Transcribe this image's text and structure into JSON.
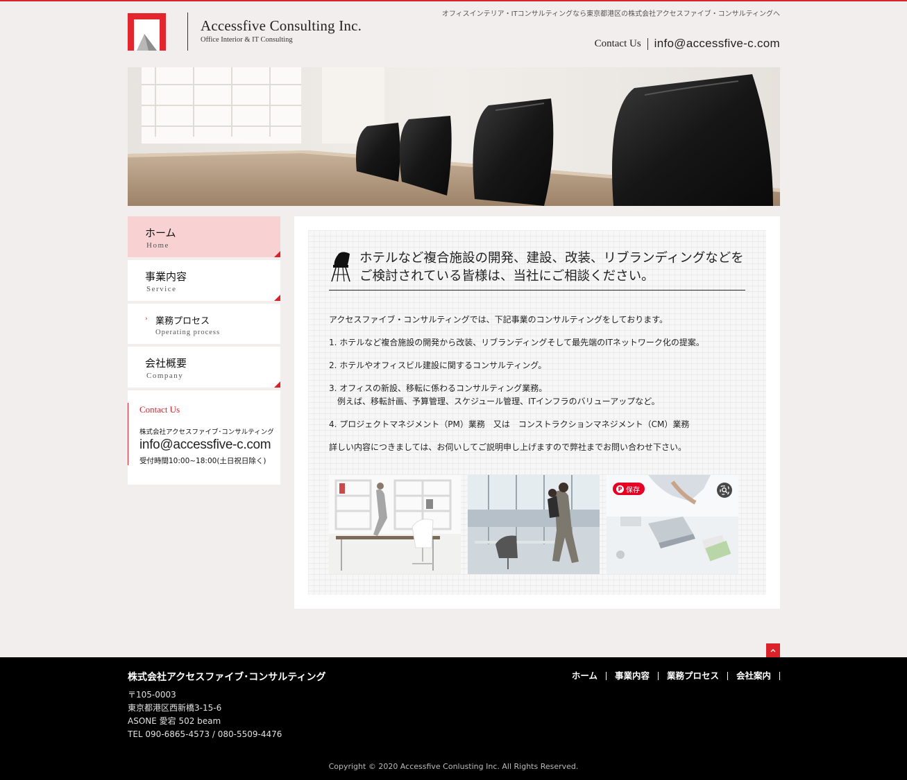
{
  "header": {
    "tagline": "オフィスインテリア・ITコンサルティングなら東京都港区の株式会社アクセスファイブ・コンサルティングへ",
    "company_name": "Accessfive Consulting Inc.",
    "company_sub": "Office Interior & IT Consulting",
    "contact_label": "Contact Us",
    "contact_email": "info@accessfive-c.com"
  },
  "sidebar": {
    "items": [
      {
        "jp": "ホーム",
        "en": "Home"
      },
      {
        "jp": "事業内容",
        "en": "Service"
      },
      {
        "jp": "業務プロセス",
        "en": "Operating process"
      },
      {
        "jp": "会社概要",
        "en": "Company"
      }
    ],
    "contact": {
      "title": "Contact Us",
      "company": "株式会社アクセスファイブ･コンサルティング",
      "email": "info@accessfive-c.com",
      "hours": "受付時間10:00~18:00(土日祝日除く)"
    }
  },
  "main": {
    "heading_line1": "ホテルなど複合施設の開発、建設、改装、リブランディングなどを",
    "heading_line2": "ご検討されている皆様は、当社にご相談ください。",
    "intro": "アクセスファイブ・コンサルティングでは、下記事業のコンサルティングをしております。",
    "item1": "1. ホテルなど複合施設の開発から改装、リブランディングそして最先端のITネットワーク化の提案。",
    "item2": "2. ホテルやオフィスビル建設に関するコンサルティング。",
    "item3": "3. オフィスの新設、移転に係わるコンサルティング業務。",
    "item3_sub": "　例えば、移転計画、予算管理、スケジュール管理、ITインフラのバリューアップなど。",
    "item4": "4. プロジェクトマネジメント（PM）業務　又は　コンストラクションマネジメント（CM）業務",
    "closing": "詳しい内容につきましては、お伺いしてご説明申し上げますので弊社までお問い合わせ下さい。",
    "save_label": "保存"
  },
  "footer": {
    "company": "株式会社アクセスファイブ･コンサルティング",
    "postal": "〒105-0003",
    "address1": "東京都港区西新橋3-15-6",
    "address2": "ASONE 愛宕 502 beam",
    "tel": "TEL 090-6865-4573 / 080-5509-4476",
    "nav": [
      "ホーム",
      "事業内容",
      "業務プロセス",
      "会社案内"
    ],
    "copyright": "Copyright © 2020 Accessfive Conlusting Inc. All Rights Reserved."
  },
  "colors": {
    "accent": "#d9222a",
    "active_nav": "#f8d1d2",
    "page_bg": "#f2eeed",
    "footer_bg": "#000000"
  }
}
